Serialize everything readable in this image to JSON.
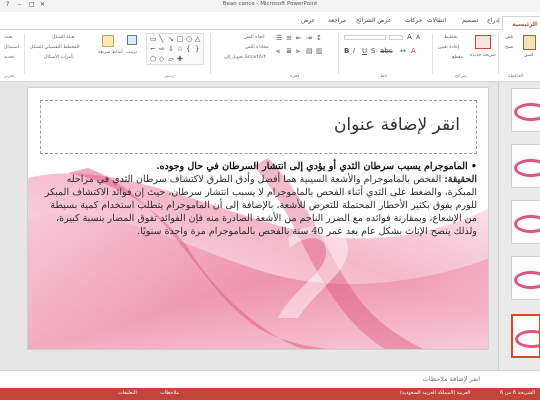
{
  "window": {
    "title": "Bean cance - Microsoft PowerPoint",
    "controls": [
      "?",
      "–",
      "□",
      "✕"
    ]
  },
  "tabs": {
    "file": "",
    "items": [
      "الرئيسية",
      "إدراج",
      "تصميم",
      "انتقالات",
      "حركات",
      "عرض الشرائح",
      "مراجعة",
      "عرض"
    ],
    "active": "الرئيسية"
  },
  "ribbon": {
    "clipboard": [
      "لصق",
      "قص",
      "نسخ",
      "نسخ التنسيق"
    ],
    "slides": [
      "شريحة جديدة",
      "تخطيط",
      "إعادة تعيين",
      "مقطع"
    ],
    "drawing": [
      "تعبئة الشكل",
      "المخطط التفصيلي للشكل",
      "تأثيرات الأشكال"
    ],
    "arrange": "ترتيب",
    "quick_styles": "أنماط سريعة",
    "editing": [
      "بحث",
      "استبدال",
      "تحديد"
    ],
    "paragraph_items": [
      "اتجاه النص",
      "محاذاة النص",
      "تحويل إلى SmartArt"
    ],
    "groups": [
      "تحرير",
      "رسم",
      "فقرة",
      "خط",
      "شرائح",
      "الحافظة"
    ]
  },
  "slide": {
    "title_placeholder": "انقر لإضافة عنوان",
    "bullet_heading": "• الماموجرام يسبب سرطان الثدي أو يؤدي إلى انتشار السرطان في حال وجوده.",
    "fact_label": "الحقيقة:",
    "fact_text": "الفحص بالماموجرام والأشعة السينية هما أفضل وأدق الطرق لاكتشاف سرطان الثدي في مراحله المبكرة، والضغط على الثدي أثناء الفحص بالماموجرام لا يسبب انتشار سرطان، حيث إن فوائد الاكتشاف المبكر للورم يفوق بكثير الأخطار المحتملة للتعرض للأشعة، بالإضافة إلى أن الماموجرام يتطلب استخدام كمية بسيطة من الإشعاع، وبمقارنة فوائده مع الضرر الناجم من الأشعة الصادرة منه فإن الفوائد تفوق المضار بنسبة كبيرة، ولذلك ينصح الإناث بشكل عام بعد عمر 40 سنة بالفحص بالماموجرام مرة واحدة سنويًا."
  },
  "notes": {
    "placeholder": "انقر لإضافة ملاحظات"
  },
  "status": {
    "left": [
      "الشريحة 6 من 6",
      "العربية (المملكة العربية السعودية)"
    ],
    "right": [
      "ملاحظات",
      "التعليقات"
    ]
  },
  "colors": {
    "accent": "#c4433a",
    "ribbon_pink": "#e2567e",
    "thumb_selected": "#d64b2a"
  }
}
